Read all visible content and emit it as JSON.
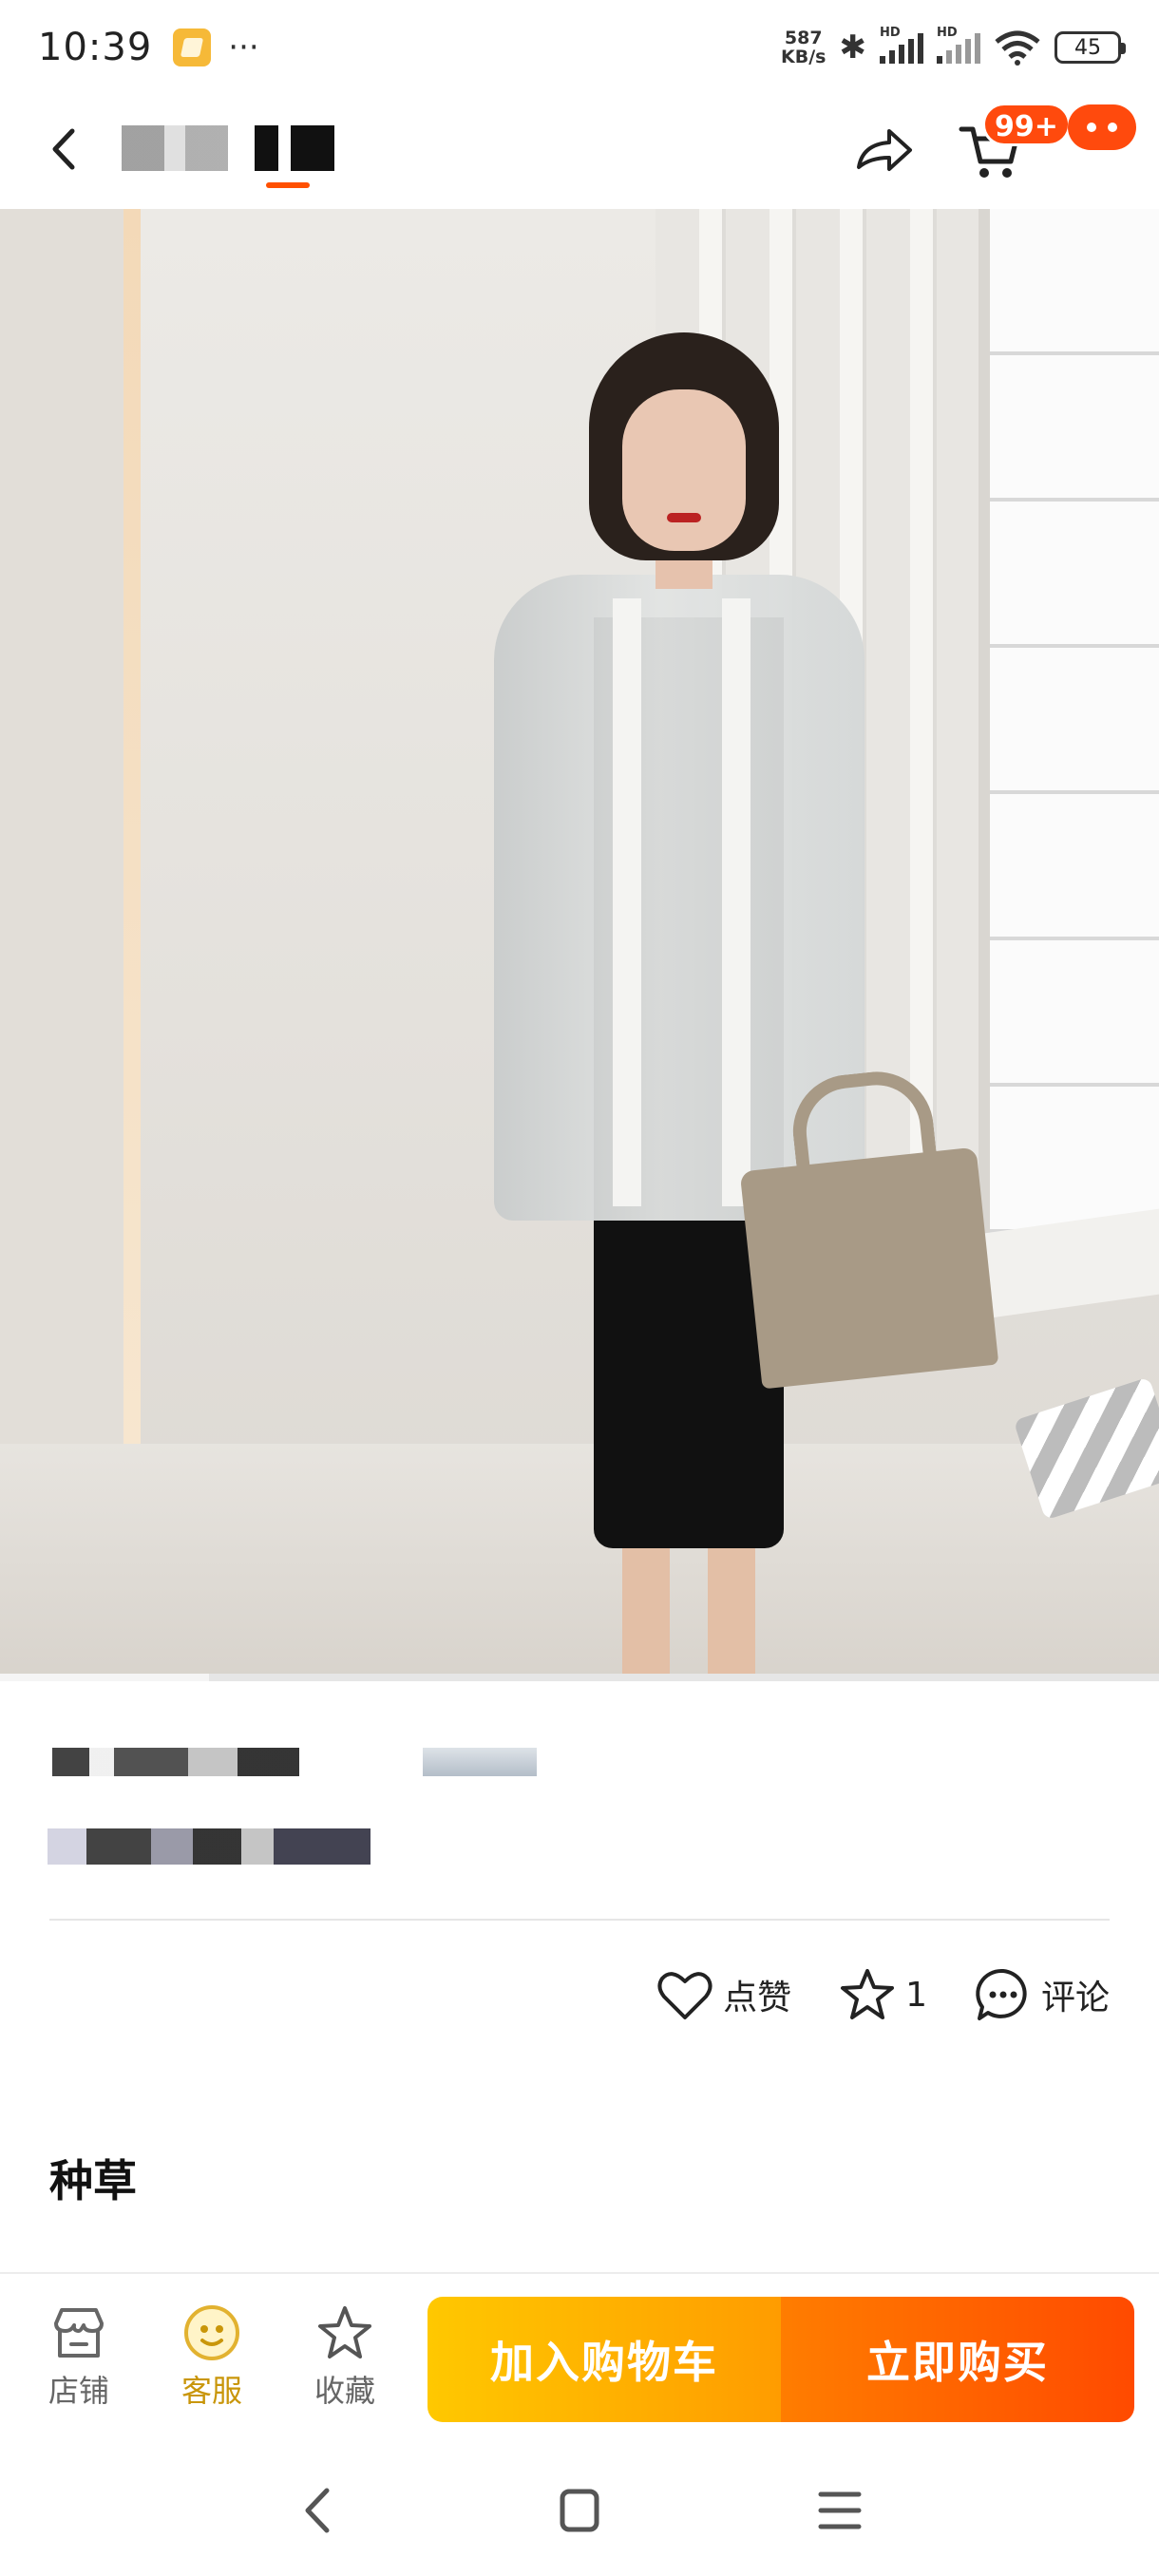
{
  "status_bar": {
    "time": "10:39",
    "dots": "···",
    "net_speed_value": "587",
    "net_speed_unit": "KB/s",
    "signal_label_1": "HD",
    "signal_label_2": "HD",
    "battery": "45"
  },
  "nav": {
    "cart_badge": "99+"
  },
  "video": {
    "progress": 0.18
  },
  "actions": {
    "like_label": "点赞",
    "favorite_count": "1",
    "comment_label": "评论"
  },
  "section": {
    "title": "种草"
  },
  "bottom_bar": {
    "shop_label": "店铺",
    "service_label": "客服",
    "favorite_label": "收藏",
    "add_to_cart_label": "加入购物车",
    "buy_now_label": "立即购买"
  },
  "colors": {
    "accent": "#ff5000",
    "cart_button_start": "#ffc800",
    "buy_button_end": "#ff4a00",
    "service_gold": "#c9960a"
  },
  "icons": [
    "back-icon",
    "share-icon",
    "cart-icon",
    "more-icon",
    "heart-icon",
    "star-icon",
    "comment-icon",
    "shop-icon",
    "service-icon",
    "favorite-icon"
  ]
}
